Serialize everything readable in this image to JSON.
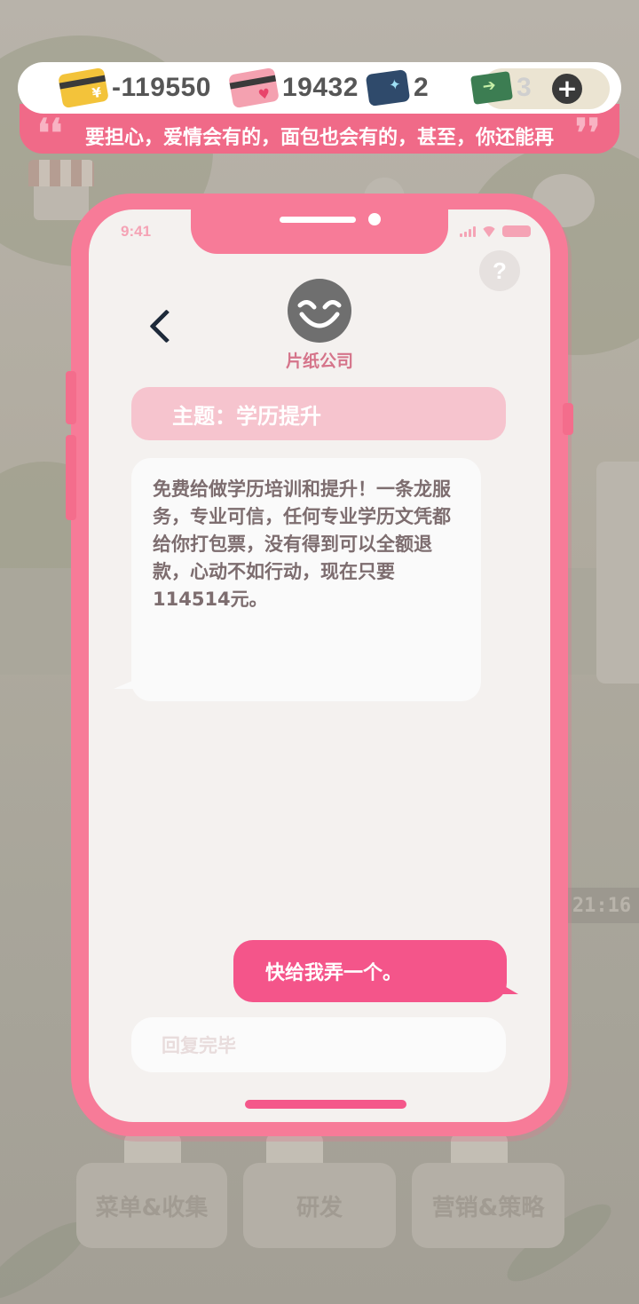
{
  "resources": {
    "gold_money": "-119550",
    "love_money": "19432",
    "blue_cards": "2",
    "tickets": "3"
  },
  "quote": {
    "open_mark": "❛❛",
    "text": "要担心，爱情会有的，面包也会有的，甚至，你还能再",
    "close_mark": "❜❜"
  },
  "phone": {
    "status_time": "9:41",
    "help_label": "?",
    "sender": "片纸公司",
    "subject": "主题：学历提升",
    "incoming_message": "免费给做学历培训和提升！一条龙服务，专业可信，任何专业学历文凭都给你打包票，没有得到可以全额退款，心动不如行动，现在只要114514元。",
    "outgoing_message": "快给我弄一个。",
    "reply_placeholder": "回复完毕"
  },
  "background": {
    "clock": "21:16",
    "tabs": [
      "菜单&收集",
      "研发",
      "营销&策略"
    ]
  },
  "icons": {
    "gold": "gold-card-icon",
    "love": "love-card-icon",
    "blue": "blue-card-icon",
    "ticket": "ticket-icon",
    "add": "plus-icon",
    "back": "back-chevron-icon",
    "help": "help-icon",
    "avatar": "grin-face-icon"
  },
  "colors": {
    "accent_pink": "#f77b98",
    "bubble_pink": "#f4558a",
    "subject_pink": "#f6c4ce",
    "text_brown": "#7d6d6f"
  }
}
